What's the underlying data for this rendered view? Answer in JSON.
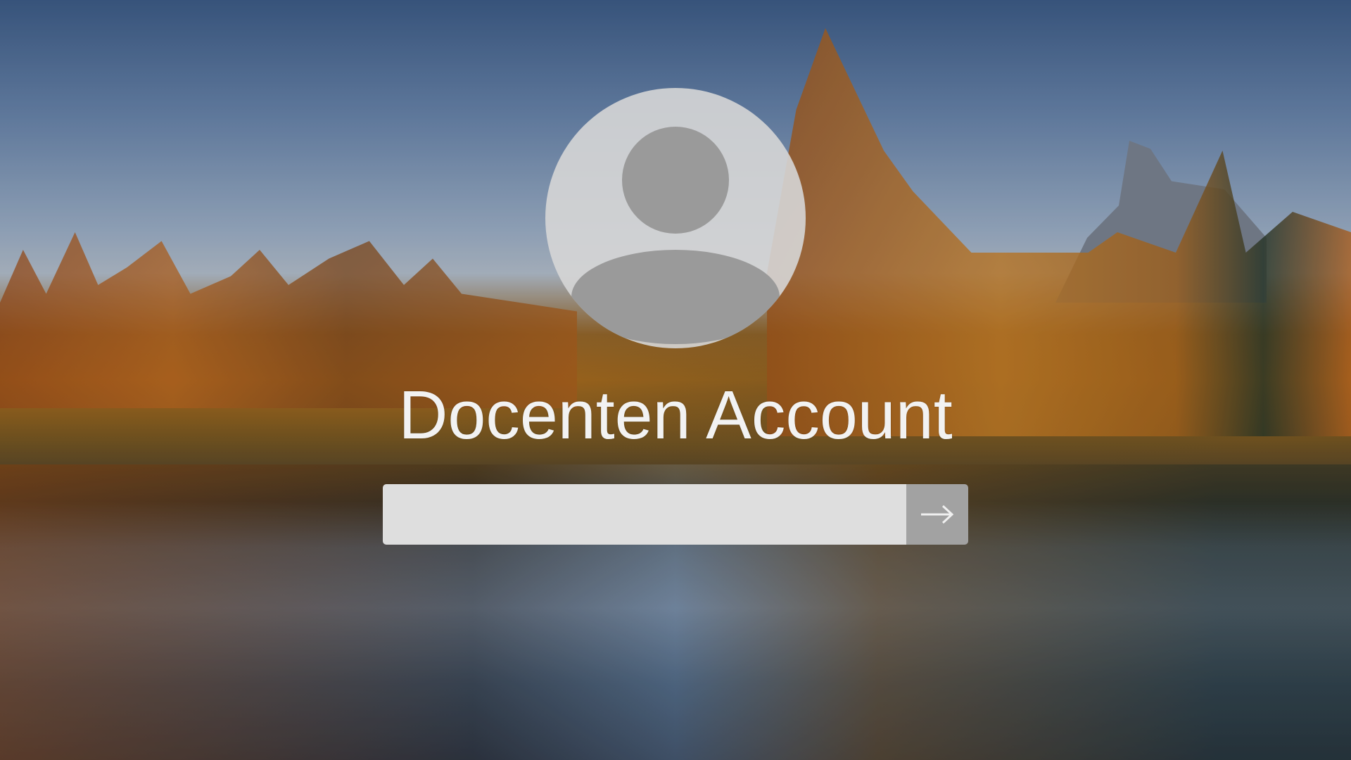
{
  "login": {
    "account_name": "Docenten Account",
    "password_value": "",
    "password_placeholder": "",
    "submit_icon": "arrow-right-icon"
  },
  "colors": {
    "input_background": "#dedede",
    "submit_background": "#a2a2a2",
    "avatar_circle": "#d6d6d6",
    "avatar_figure": "#9a9a9a",
    "title_text": "#f2f2f2"
  }
}
